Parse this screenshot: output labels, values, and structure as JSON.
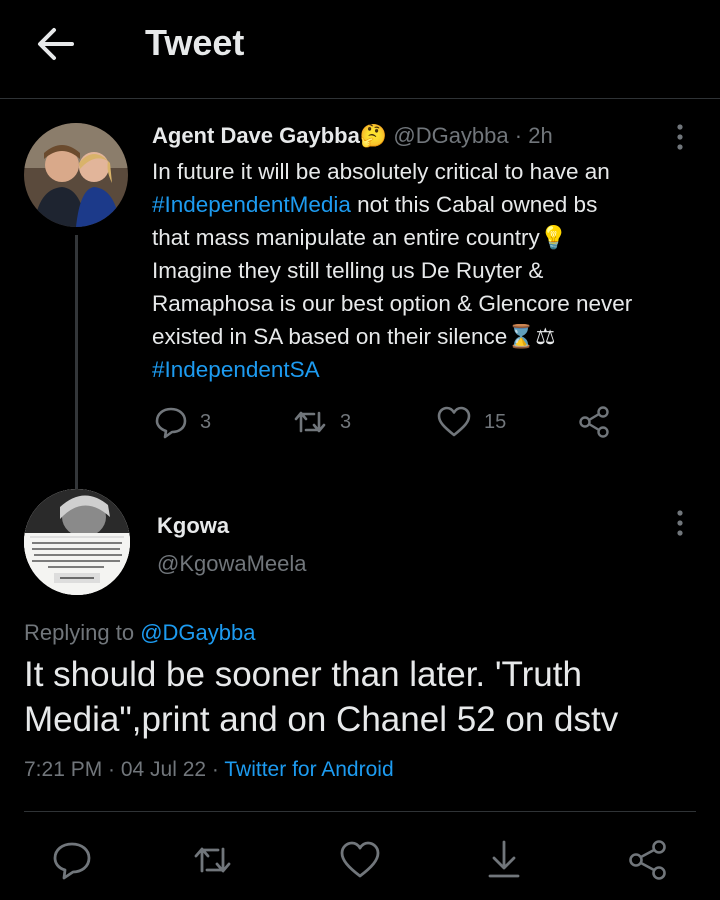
{
  "header": {
    "title": "Tweet"
  },
  "parent_tweet": {
    "author_name": "Agent Dave Gaybba🤔",
    "handle": "@DGaybba",
    "separator": "·",
    "time": "2h",
    "text_line1": "In future it will be absolutely critical to have an",
    "hashtag1": "#IndependentMedia",
    "text_line2_rest": " not this Cabal owned bs",
    "text_line3": "that mass manipulate an entire country💡",
    "text_line4": "Imagine they still telling us De Ruyter &",
    "text_line5": "Ramaphosa is our best option & Glencore never",
    "text_line6": "existed in SA based on their silence⌛⚖",
    "hashtag2": "#IndependentSA",
    "reply_count": "3",
    "retweet_count": "3",
    "like_count": "15"
  },
  "reply": {
    "author_name": "Kgowa",
    "handle": "@KgowaMeela",
    "replying_label": "Replying to ",
    "replying_to": "@DGaybba",
    "text_line1": "It should be sooner than later. 'Truth",
    "text_line2": "Media\",print and on Chanel 52 on dstv",
    "meta_time": "7:21 PM · 04 Jul 22 · ",
    "meta_source": "Twitter for Android",
    "avatar_quote": "The difference between a democracy and a dictatorship is that in a democracy you vote first and take orders later; in a dictatorship you don't have to waste your time voting",
    "avatar_author": "Bukowski"
  },
  "colors": {
    "accent": "#1d9bf0",
    "muted": "#71767b",
    "text": "#e7e9ea",
    "background": "#000000"
  }
}
